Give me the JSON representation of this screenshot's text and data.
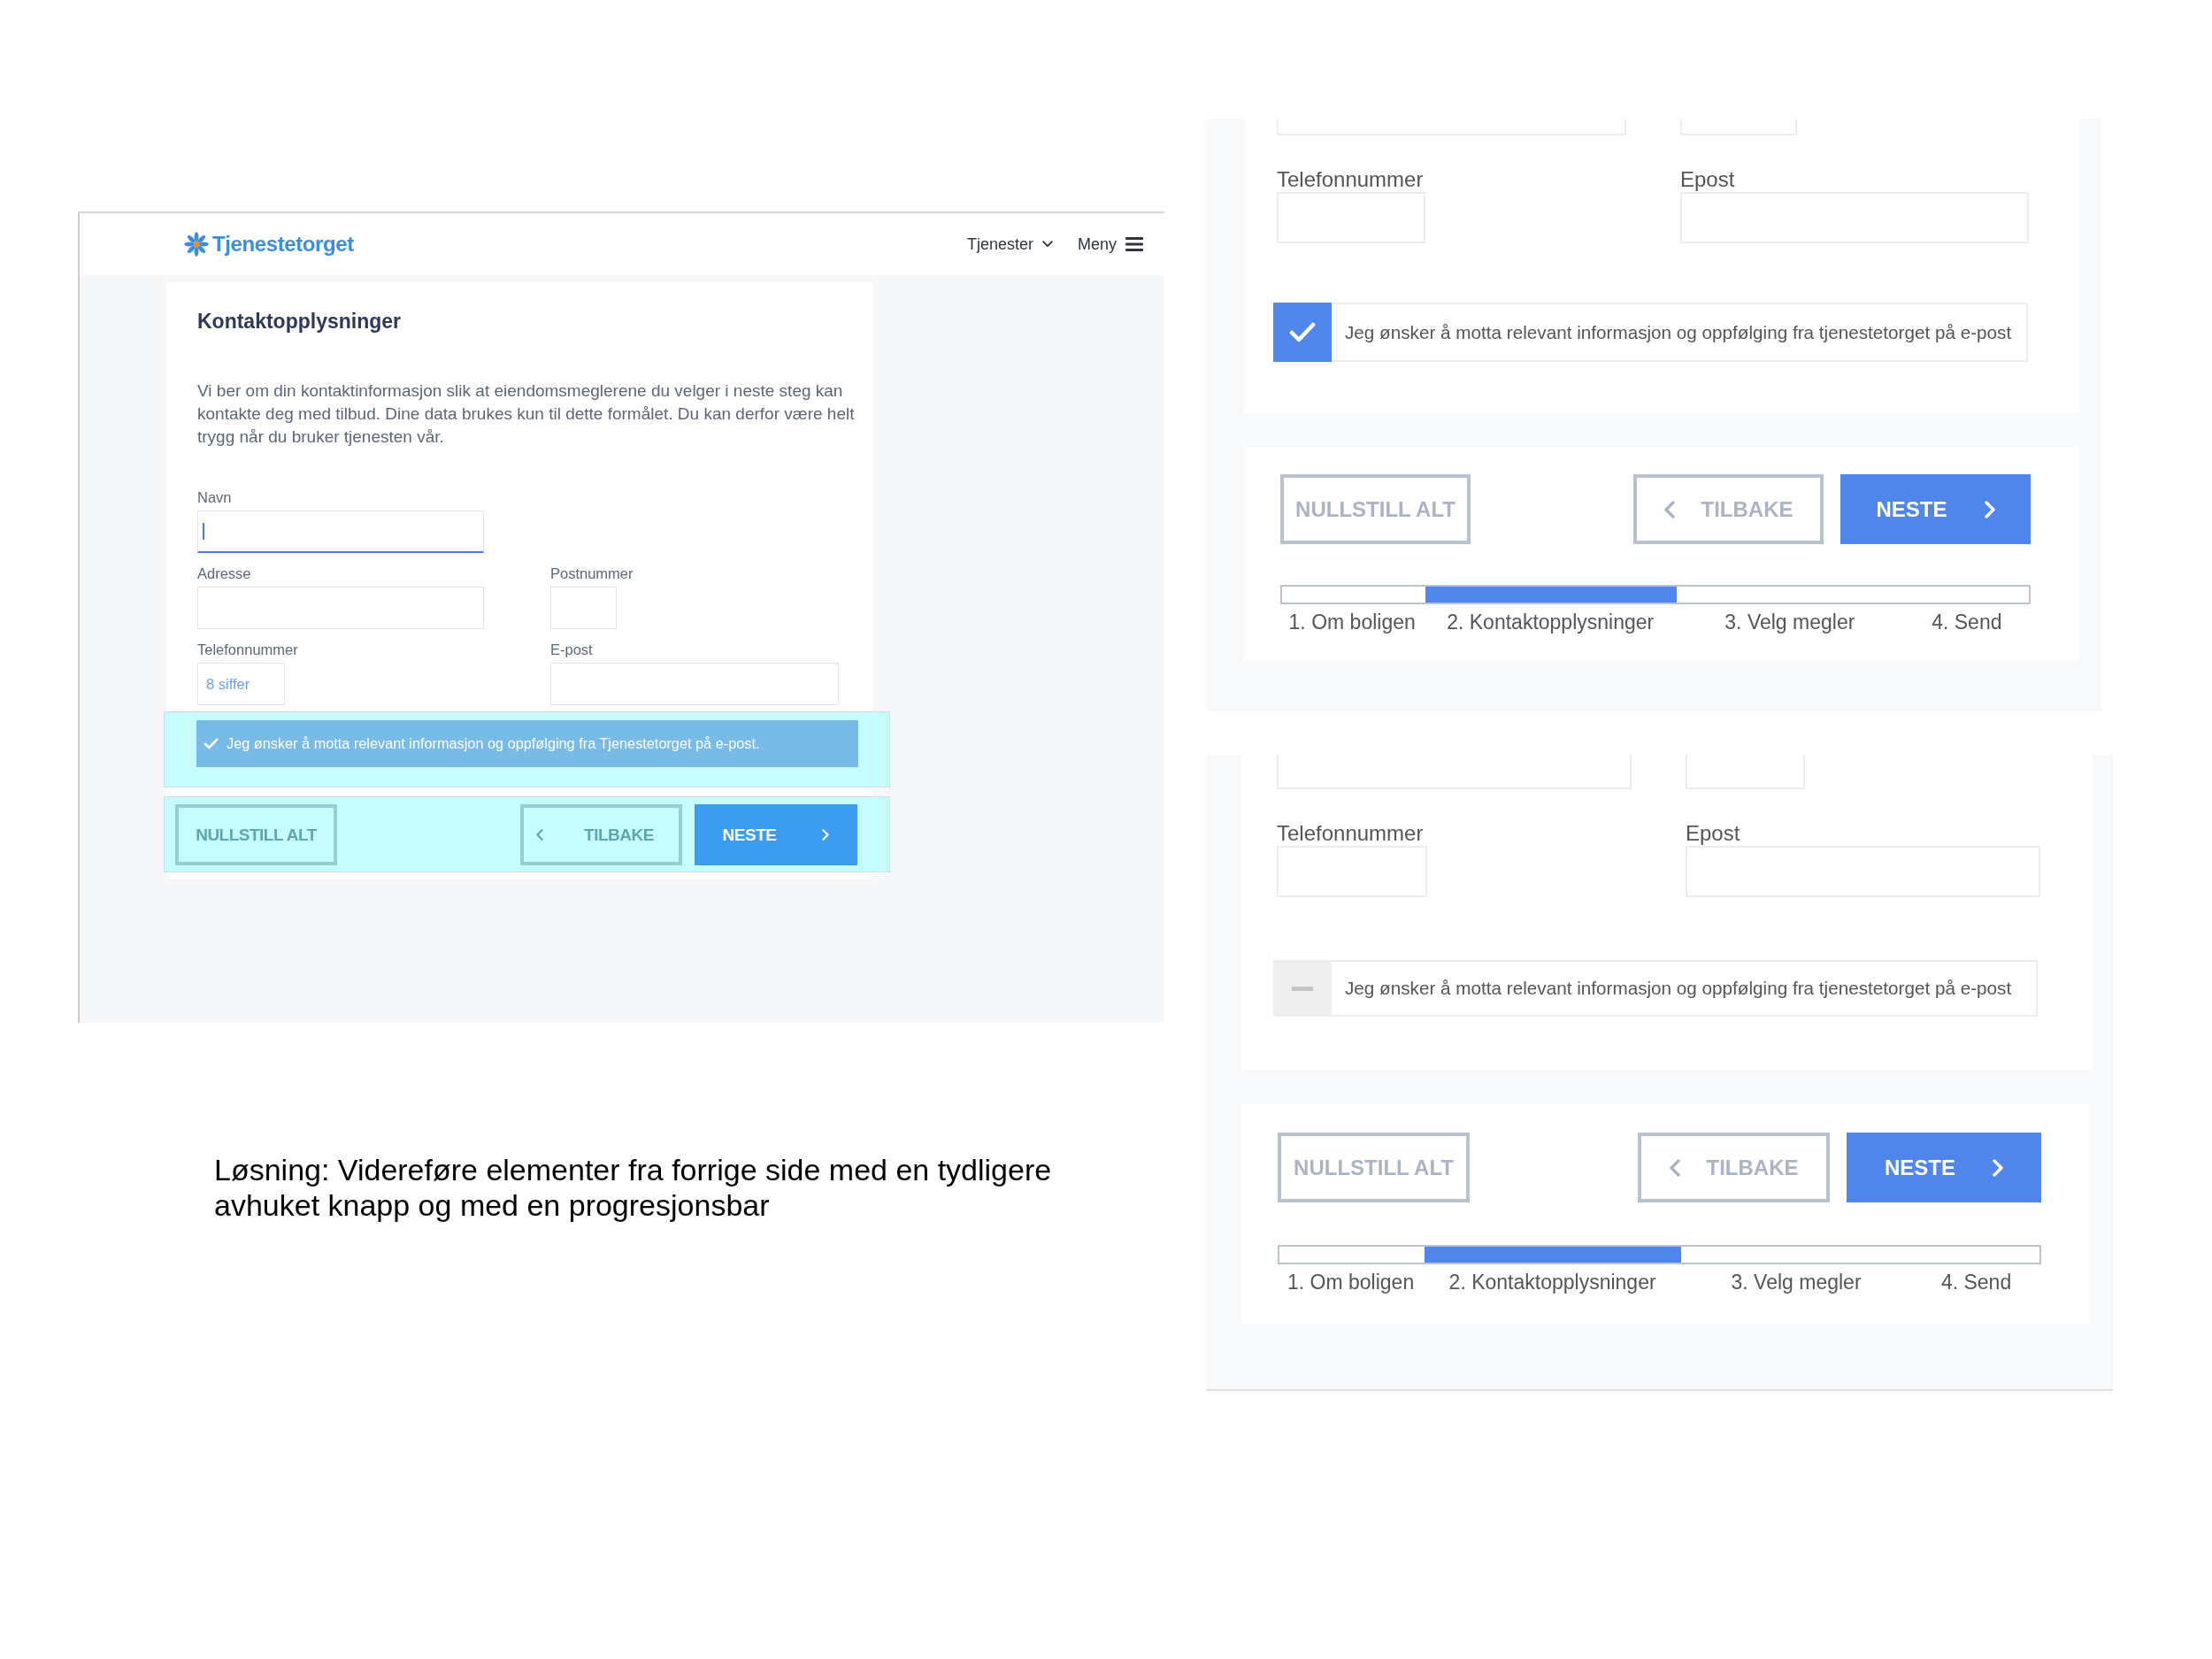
{
  "left_screenshot": {
    "header": {
      "logo": "Tjenestetorget",
      "nav": [
        {
          "label": "Tjenester",
          "kind": "dropdown"
        },
        {
          "label": "Meny",
          "kind": "menu"
        }
      ]
    },
    "form": {
      "title": "Kontaktopplysninger",
      "intro": "Vi ber om din kontaktinformasjon slik at eiendomsmeglerene du velger i neste steg kan kontakte deg med tilbud. Dine data brukes kun til dette formålet. Du kan derfor være helt trygg når du bruker tjenesten vår.",
      "field_rows": [
        [
          {
            "label": "Navn",
            "focused": true
          }
        ],
        [
          {
            "label": "Adresse",
            "focused": false
          },
          {
            "label": "Postnummer",
            "focused": false
          }
        ],
        [
          {
            "label": "Telefonnummer",
            "placeholder": "8 siffer",
            "focused": false
          },
          {
            "label": "E-post",
            "focused": false
          }
        ]
      ],
      "consent": {
        "label": "Jeg ønsker å motta relevant informasjon og oppfølging fra Tjenestetorget på e-post.",
        "checked": true,
        "highlighted": true
      },
      "button_bar": {
        "highlighted": true,
        "buttons": [
          {
            "kind": "reset",
            "label": "NULLSTILL ALT"
          },
          {
            "kind": "back",
            "label": "TILBAKE"
          },
          {
            "kind": "next",
            "label": "NESTE"
          }
        ]
      }
    }
  },
  "caption": "Løsning: Videreføre elementer fra forrige side med en tydligere avhuket knapp og med en progresjonsbar",
  "variants": [
    {
      "field_rows": [
        [
          {
            "kind": "cut-off"
          },
          {
            "kind": "cut-off"
          }
        ],
        [
          {
            "kind": "text",
            "label": "Telefonnummer"
          },
          {
            "kind": "text",
            "label": "Epost"
          }
        ]
      ],
      "consent": {
        "label": "Jeg ønsker å motta relevant informasjon og oppfølging fra tjenestetorget på e-post",
        "checked": true
      },
      "buttons": [
        {
          "kind": "reset",
          "label": "NULLSTILL ALT"
        },
        {
          "kind": "back",
          "label": "TILBAKE"
        },
        {
          "kind": "next",
          "label": "NESTE"
        }
      ],
      "progress": {
        "steps": [
          {
            "label": "1. Om boligen",
            "selected": false
          },
          {
            "label": "2. Kontaktopplysninger",
            "selected": true
          },
          {
            "label": "3. Velg megler",
            "selected": false
          },
          {
            "label": "4. Send",
            "selected": false
          }
        ]
      }
    },
    {
      "field_rows": [
        [
          {
            "kind": "cut-off"
          },
          {
            "kind": "cut-off"
          }
        ],
        [
          {
            "kind": "text",
            "label": "Telefonnummer"
          },
          {
            "kind": "text",
            "label": "Epost"
          }
        ]
      ],
      "consent": {
        "label": "Jeg ønsker å motta relevant informasjon og oppfølging fra tjenestetorget på e-post",
        "checked": false
      },
      "buttons": [
        {
          "kind": "reset",
          "label": "NULLSTILL ALT"
        },
        {
          "kind": "back",
          "label": "TILBAKE"
        },
        {
          "kind": "next",
          "label": "NESTE"
        }
      ],
      "progress": {
        "steps": [
          {
            "label": "1. Om boligen",
            "selected": false
          },
          {
            "label": "2. Kontaktopplysninger",
            "selected": true
          },
          {
            "label": "3. Velg megler",
            "selected": false
          },
          {
            "label": "4. Send",
            "selected": false
          }
        ]
      }
    }
  ]
}
